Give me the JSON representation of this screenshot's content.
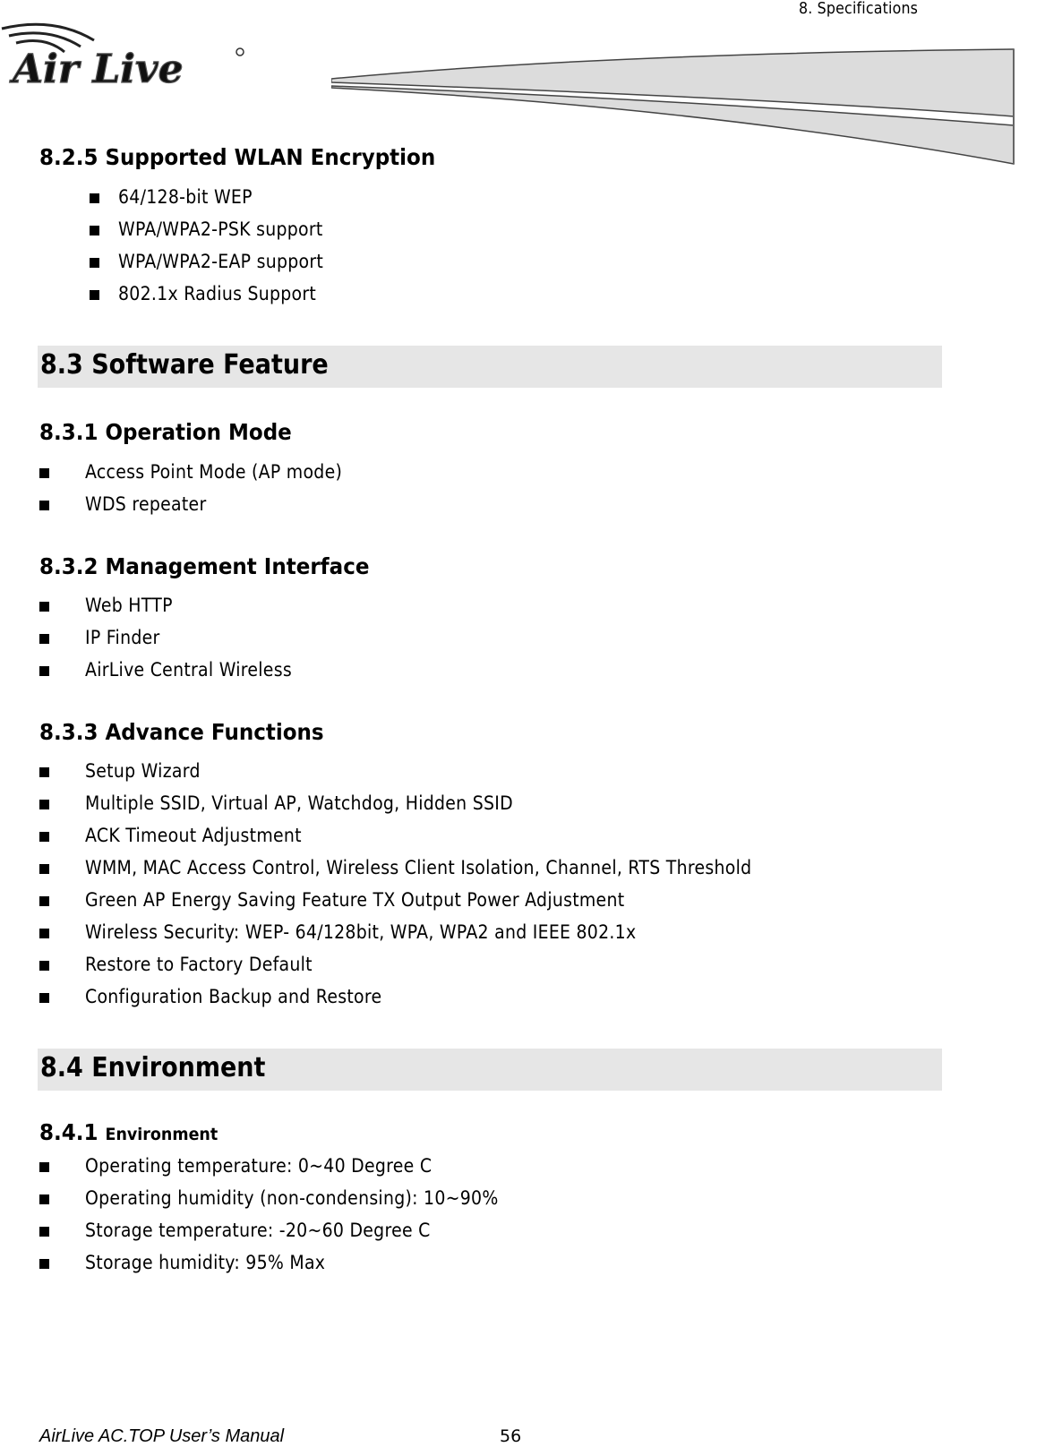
{
  "header": {
    "chapter_title": "8.  Specifications",
    "logo_text": "Air Live"
  },
  "sections": {
    "s825": {
      "heading": "8.2.5 Supported WLAN Encryption",
      "items": [
        "64/128-bit WEP",
        "WPA/WPA2-PSK support",
        "WPA/WPA2-EAP support",
        "802.1x Radius Support"
      ]
    },
    "s83": {
      "heading": "8.3 Software Feature"
    },
    "s831": {
      "heading": "8.3.1 Operation Mode",
      "items": [
        "Access Point Mode (AP mode)",
        "WDS repeater"
      ]
    },
    "s832": {
      "heading": "8.3.2 Management Interface",
      "items": [
        "Web HTTP",
        "IP Finder",
        "AirLive Central Wireless"
      ]
    },
    "s833": {
      "heading": "8.3.3 Advance Functions",
      "items": [
        "Setup Wizard",
        "Multiple SSID, Virtual AP, Watchdog, Hidden SSID",
        "ACK Timeout Adjustment",
        "WMM, MAC Access Control, Wireless Client Isolation, Channel, RTS Threshold",
        "Green AP Energy Saving Feature TX Output Power Adjustment",
        "Wireless Security: WEP- 64/128bit, WPA, WPA2 and IEEE 802.1x",
        "Restore to Factory Default",
        "Configuration Backup and Restore"
      ]
    },
    "s84": {
      "heading": "8.4 Environment"
    },
    "s841": {
      "heading_num": "8.4.1",
      "heading_text": "Environment",
      "items": [
        "Operating temperature: 0~40 Degree C",
        "Operating humidity (non-condensing): 10~90%",
        "Storage temperature: -20~60 Degree C",
        "Storage humidity: 95% Max"
      ]
    }
  },
  "footer": {
    "manual_title": "AirLive AC.TOP User’s Manual",
    "page_number": "56"
  }
}
